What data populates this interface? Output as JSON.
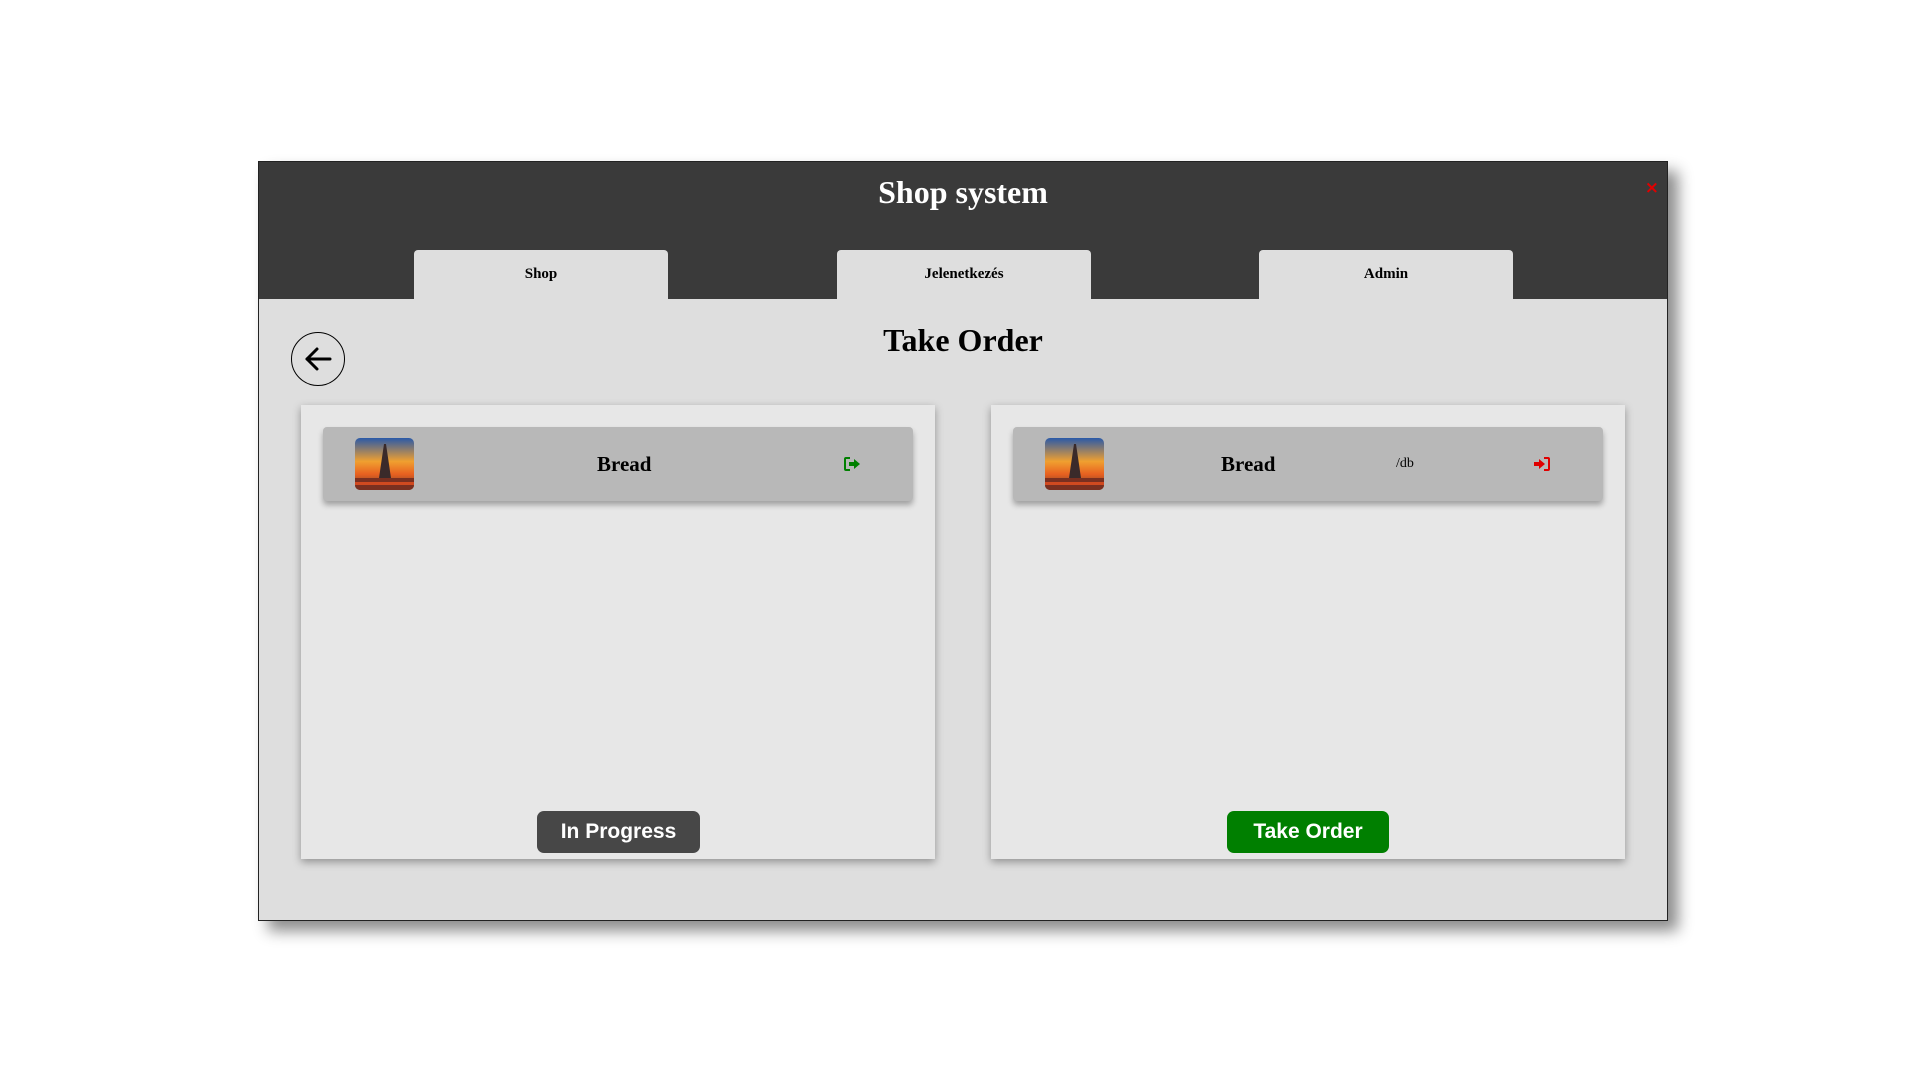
{
  "window": {
    "title": "Shop system",
    "close_label": "×"
  },
  "tabs": [
    {
      "label": "Shop"
    },
    {
      "label": "Jelenetkezés"
    },
    {
      "label": "Admin"
    }
  ],
  "page": {
    "title": "Take Order"
  },
  "left_panel": {
    "item": {
      "name": "Bread",
      "icon": "sign-out-icon",
      "icon_color": "#008000"
    },
    "button_label": "In Progress"
  },
  "right_panel": {
    "item": {
      "name": "Bread",
      "unit": "/db",
      "icon": "sign-in-icon",
      "icon_color": "#e00000"
    },
    "button_label": "Take Order"
  }
}
